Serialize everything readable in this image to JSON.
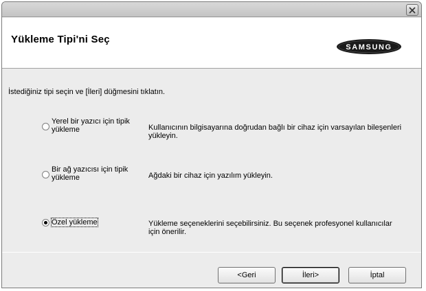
{
  "header": {
    "title": "Yükleme Tipi'ni Seç",
    "logo_text": "SAMSUNG"
  },
  "instruction": "İstediğiniz tipi seçin ve [İleri] düğmesini tıklatın.",
  "options": [
    {
      "label_line1": "Yerel bir yazıcı için tipik",
      "label_line2": "yükleme",
      "desc_line1": "Kullanıcının bilgisayarına doğrudan bağlı bir cihaz için varsayılan bileşenleri",
      "desc_line2": "yükleyin.",
      "selected": false
    },
    {
      "label_line1": "Bir ağ yazıcısı için tipik",
      "label_line2": "yükleme",
      "desc_line1": "Ağdaki bir cihaz için yazılım yükleyin.",
      "desc_line2": "",
      "selected": false
    },
    {
      "label_line1": "Özel yükleme",
      "label_line2": "",
      "desc_line1": "Yükleme seçeneklerini seçebilirsiniz. Bu seçenek profesyonel kullanıcılar",
      "desc_line2": "için önerilir.",
      "selected": true
    }
  ],
  "buttons": {
    "back": "<Geri",
    "next": "İleri>",
    "cancel": "İptal"
  },
  "colors": {
    "window_bg": "#ececec",
    "header_bg": "#ffffff",
    "logo_bg": "#1a1a1a"
  }
}
